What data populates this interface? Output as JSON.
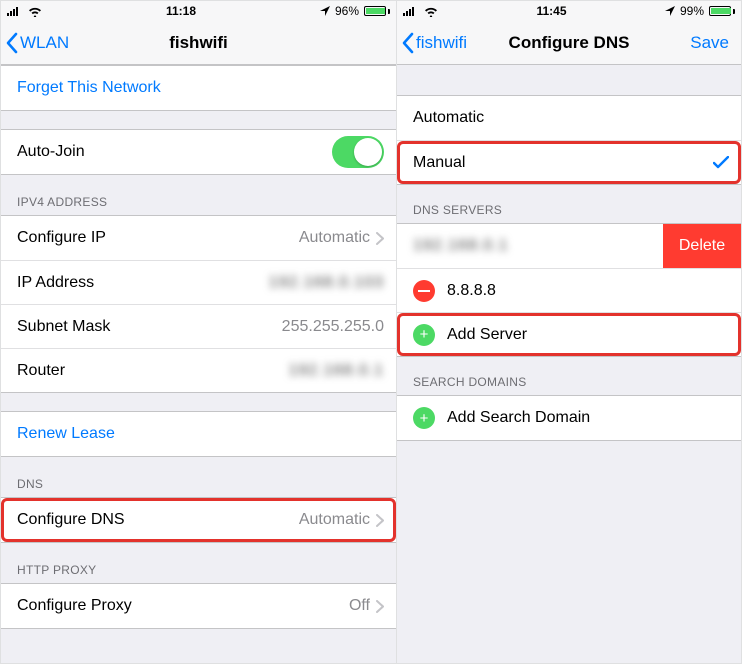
{
  "left": {
    "statusbar": {
      "time": "11:18",
      "battery": "96%",
      "location": true
    },
    "nav": {
      "back": "WLAN",
      "title": "fishwifi"
    },
    "forget": "Forget This Network",
    "auto_join_label": "Auto-Join",
    "sections": {
      "ipv4_header": "IPV4 ADDRESS",
      "configure_ip_label": "Configure IP",
      "configure_ip_value": "Automatic",
      "ip_label": "IP Address",
      "ip_value": "192.168.0.103",
      "subnet_label": "Subnet Mask",
      "subnet_value": "255.255.255.0",
      "router_label": "Router",
      "router_value": "192.168.0.1",
      "renew_lease": "Renew Lease",
      "dns_header": "DNS",
      "configure_dns_label": "Configure DNS",
      "configure_dns_value": "Automatic",
      "proxy_header": "HTTP PROXY",
      "configure_proxy_label": "Configure Proxy",
      "configure_proxy_value": "Off"
    }
  },
  "right": {
    "statusbar": {
      "time": "11:45",
      "battery": "99%",
      "location": true
    },
    "nav": {
      "back": "fishwifi",
      "title": "Configure DNS",
      "save": "Save"
    },
    "options": {
      "automatic": "Automatic",
      "manual": "Manual"
    },
    "dns_servers_header": "DNS SERVERS",
    "dns_server_1": "192.168.0.1",
    "dns_server_2": "8.8.8.8",
    "add_server": "Add Server",
    "delete_label": "Delete",
    "search_header": "SEARCH DOMAINS",
    "add_search_domain": "Add Search Domain"
  }
}
